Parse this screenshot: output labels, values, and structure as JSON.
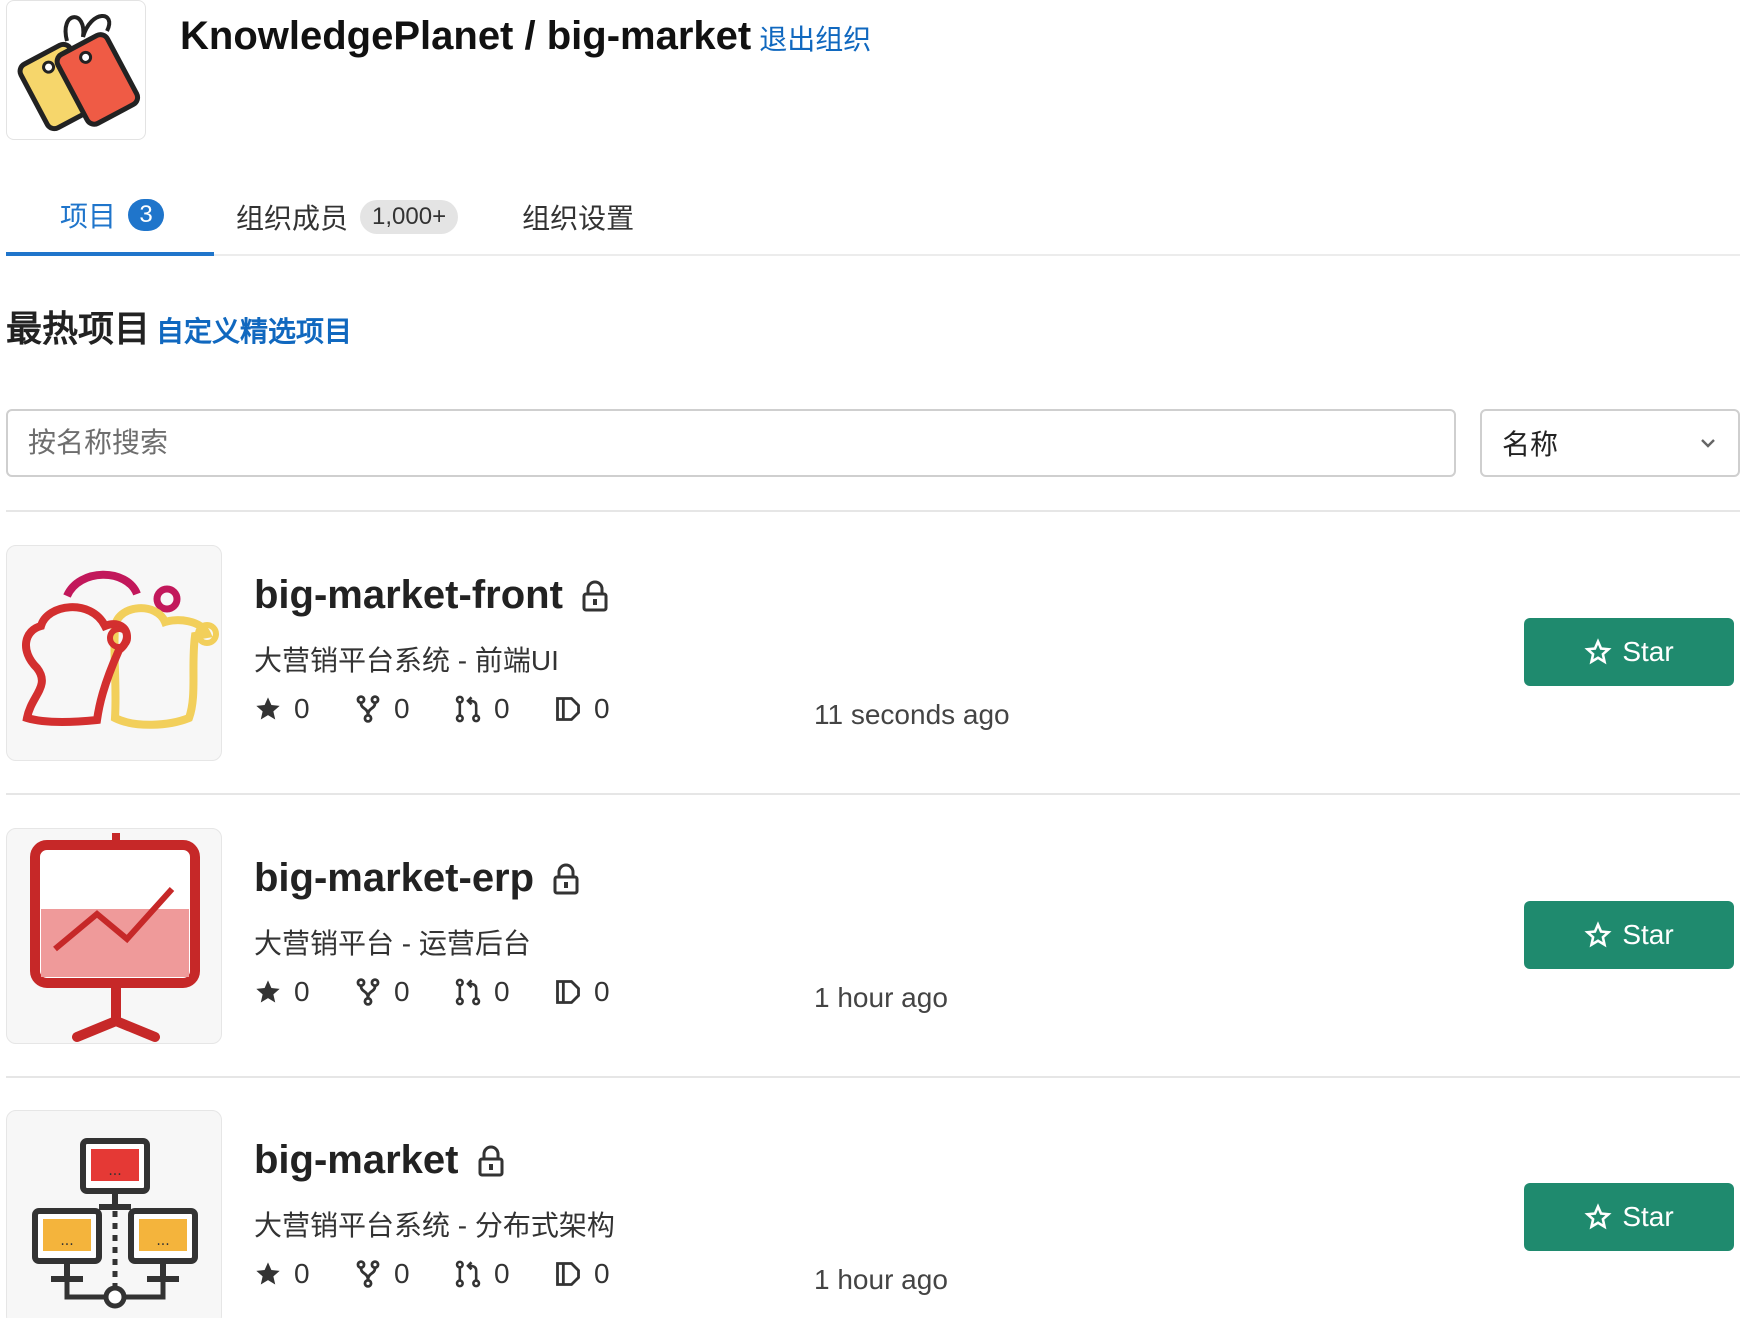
{
  "org": {
    "title": "KnowledgePlanet / big-market",
    "leave_label": "退出组织",
    "logo_icon": "sale-tags-icon"
  },
  "tabs": [
    {
      "label": "项目",
      "badge": "3",
      "active": true
    },
    {
      "label": "组织成员",
      "badge": "1,000+",
      "active": false
    },
    {
      "label": "组织设置",
      "active": false
    }
  ],
  "section": {
    "title": "最热项目",
    "custom_label": "自定义精选项目"
  },
  "search": {
    "placeholder": "按名称搜索"
  },
  "sort": {
    "selected": "名称"
  },
  "projects": [
    {
      "name": "big-market-front",
      "description": "大营销平台系统 - 前端UI",
      "stars": "0",
      "forks": "0",
      "merge_requests": "0",
      "issues": "0",
      "updated": "11 seconds ago",
      "star_label": "Star",
      "avatar_icon": "chat-bubbles-icon"
    },
    {
      "name": "big-market-erp",
      "description": "大营销平台 - 运营后台",
      "stars": "0",
      "forks": "0",
      "merge_requests": "0",
      "issues": "0",
      "updated": "1 hour ago",
      "star_label": "Star",
      "avatar_icon": "presentation-chart-icon"
    },
    {
      "name": "big-market",
      "description": "大营销平台系统 - 分布式架构",
      "stars": "0",
      "forks": "0",
      "merge_requests": "0",
      "issues": "0",
      "updated": "1 hour ago",
      "star_label": "Star",
      "avatar_icon": "network-computers-icon"
    }
  ],
  "colors": {
    "accent": "#1f75cb",
    "link": "#1068bf",
    "star_button": "#1f8a6e"
  }
}
